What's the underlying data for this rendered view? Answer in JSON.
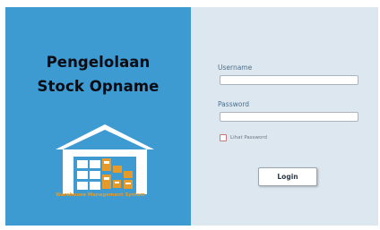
{
  "left": {
    "title_line1": "Pengelolaan",
    "title_line2": "Stock Opname",
    "logo_caption": "Warehouse Management System"
  },
  "form": {
    "username_label": "Username",
    "username_value": "",
    "password_label": "Password",
    "password_value": "",
    "show_password_label": "Lihat Password",
    "show_password_checked": false,
    "login_label": "Login"
  },
  "colors": {
    "left_panel": "#3d9bd1",
    "right_panel": "#dce7ef",
    "logo_accent": "#e59a2a"
  }
}
